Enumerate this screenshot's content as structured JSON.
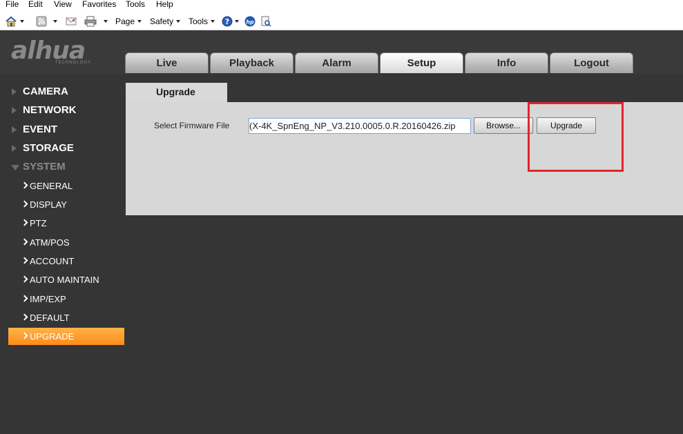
{
  "menubar": {
    "items": [
      "File",
      "Edit",
      "View",
      "Favorites",
      "Tools",
      "Help"
    ]
  },
  "commandbar": {
    "page": "Page",
    "safety": "Safety",
    "tools": "Tools"
  },
  "header": {
    "logo": "alhua",
    "logo_sub": "TECHNOLOGY",
    "tabs": [
      "Live",
      "Playback",
      "Alarm",
      "Setup",
      "Info",
      "Logout"
    ],
    "active_tab": "Setup"
  },
  "sidebar": {
    "sections": [
      "CAMERA",
      "NETWORK",
      "EVENT",
      "STORAGE",
      "SYSTEM"
    ],
    "system_items": [
      "GENERAL",
      "DISPLAY",
      "PTZ",
      "ATM/POS",
      "ACCOUNT",
      "AUTO MAINTAIN",
      "IMP/EXP",
      "DEFAULT",
      "UPGRADE"
    ],
    "active_item": "UPGRADE"
  },
  "content": {
    "tab": "Upgrade",
    "firmware_label": "Select Firmware File",
    "firmware_value": "(X-4K_SpnEng_NP_V3.210.0005.0.R.20160426.zip",
    "browse_label": "Browse...",
    "upgrade_label": "Upgrade"
  },
  "colors": {
    "accent_orange": "#ff8c1a",
    "highlight_red": "#e0252d",
    "background": "#353535"
  }
}
